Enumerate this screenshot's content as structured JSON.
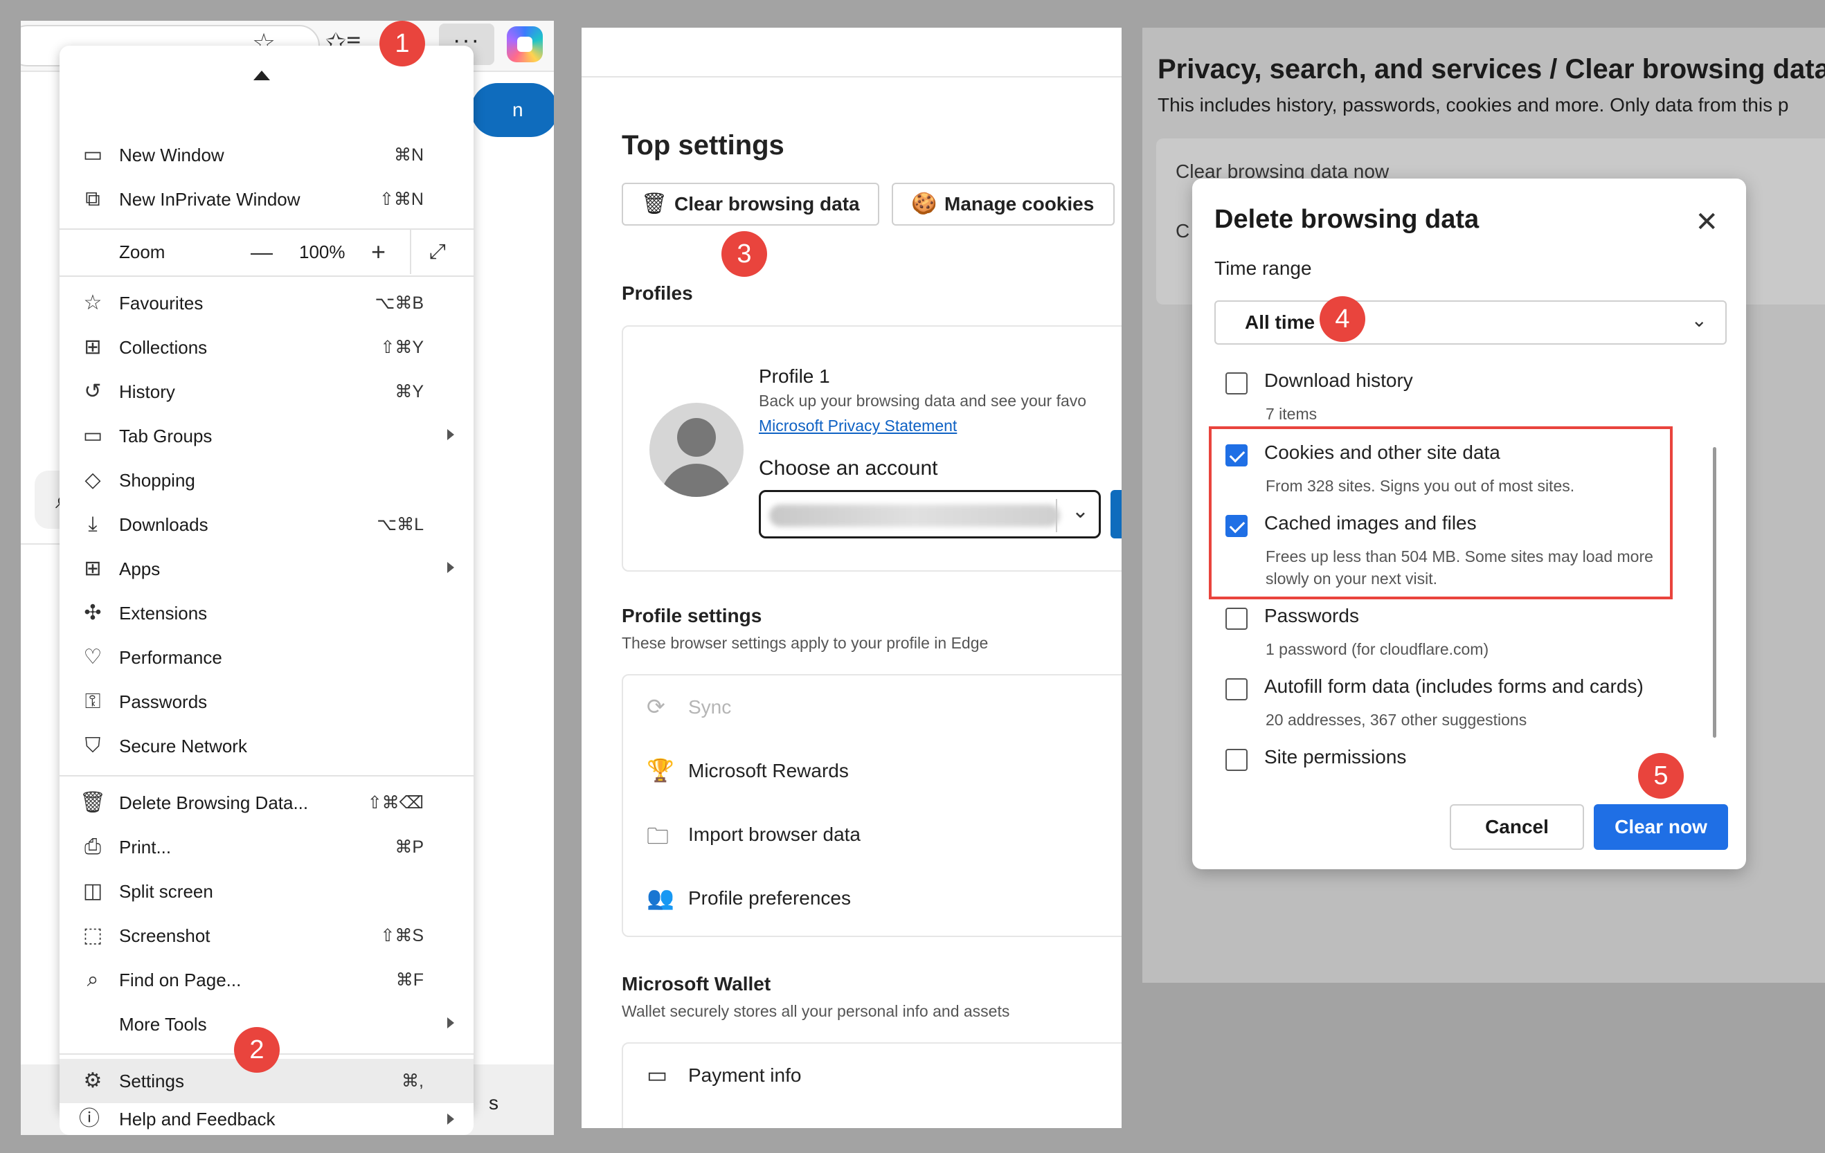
{
  "browser": {
    "blue_button_fragment": "n",
    "search_fragment": "A",
    "bottom_fragment": "s"
  },
  "menu": {
    "new_window": {
      "label": "New Window",
      "shortcut": "⌘N"
    },
    "new_inprivate": {
      "label": "New InPrivate Window",
      "shortcut": "⇧⌘N"
    },
    "zoom": {
      "label": "Zoom",
      "minus": "—",
      "value": "100%",
      "plus": "+"
    },
    "favourites": {
      "label": "Favourites",
      "shortcut": "⌥⌘B"
    },
    "collections": {
      "label": "Collections",
      "shortcut": "⇧⌘Y"
    },
    "history": {
      "label": "History",
      "shortcut": "⌘Y"
    },
    "tab_groups": {
      "label": "Tab Groups"
    },
    "shopping": {
      "label": "Shopping"
    },
    "downloads": {
      "label": "Downloads",
      "shortcut": "⌥⌘L"
    },
    "apps": {
      "label": "Apps"
    },
    "extensions": {
      "label": "Extensions"
    },
    "performance": {
      "label": "Performance"
    },
    "passwords": {
      "label": "Passwords"
    },
    "secure_network": {
      "label": "Secure Network"
    },
    "delete_browsing": {
      "label": "Delete Browsing Data...",
      "shortcut": "⇧⌘⌫"
    },
    "print": {
      "label": "Print...",
      "shortcut": "⌘P"
    },
    "split_screen": {
      "label": "Split screen"
    },
    "screenshot": {
      "label": "Screenshot",
      "shortcut": "⇧⌘S"
    },
    "find_on_page": {
      "label": "Find on Page...",
      "shortcut": "⌘F"
    },
    "more_tools": {
      "label": "More Tools"
    },
    "settings": {
      "label": "Settings",
      "shortcut": "⌘,"
    },
    "help": {
      "label": "Help and Feedback"
    }
  },
  "steps": [
    "1",
    "2",
    "3",
    "4",
    "5"
  ],
  "settings_page": {
    "top_settings": "Top settings",
    "clear_browsing_btn": "Clear browsing data",
    "manage_cookies_btn": "Manage cookies",
    "profiles_title": "Profiles",
    "profile_name": "Profile 1",
    "profile_desc": "Back up your browsing data and see your favo",
    "privacy_link": "Microsoft Privacy Statement",
    "choose_account": "Choose an account",
    "profile_settings_title": "Profile settings",
    "profile_settings_sub": "These browser settings apply to your profile in Edge",
    "rows": [
      "Sync",
      "Microsoft Rewards",
      "Import browser data",
      "Profile preferences"
    ],
    "wallet_title": "Microsoft Wallet",
    "wallet_sub": "Wallet securely stores all your personal info and assets",
    "payment_info": "Payment info"
  },
  "privacy_page": {
    "title": "Privacy, search, and services / Clear browsing data",
    "subtitle": "This includes history, passwords, cookies and more. Only data from this p",
    "card_line1": "Clear browsing data now",
    "card_line2": "C"
  },
  "dialog": {
    "title": "Delete browsing data",
    "time_range_label": "Time range",
    "time_range_value": "All time",
    "items": [
      {
        "label": "Download history",
        "desc": "7 items",
        "checked": false
      },
      {
        "label": "Cookies and other site data",
        "desc": "From 328 sites. Signs you out of most sites.",
        "checked": true
      },
      {
        "label": "Cached images and files",
        "desc": "Frees up less than 504 MB. Some sites may load more slowly on your next visit.",
        "checked": true
      },
      {
        "label": "Passwords",
        "desc": "1 password (for cloudflare.com)",
        "checked": false
      },
      {
        "label": "Autofill form data (includes forms and cards)",
        "desc": "20 addresses, 367 other suggestions",
        "checked": false
      },
      {
        "label": "Site permissions",
        "desc": "",
        "checked": false
      }
    ],
    "cancel": "Cancel",
    "clear_now": "Clear now"
  },
  "colors": {
    "badge": "#e9443d",
    "primary_blue": "#1f6fe5",
    "link_blue": "#0f62c4",
    "highlight_box": "#e9443d"
  }
}
